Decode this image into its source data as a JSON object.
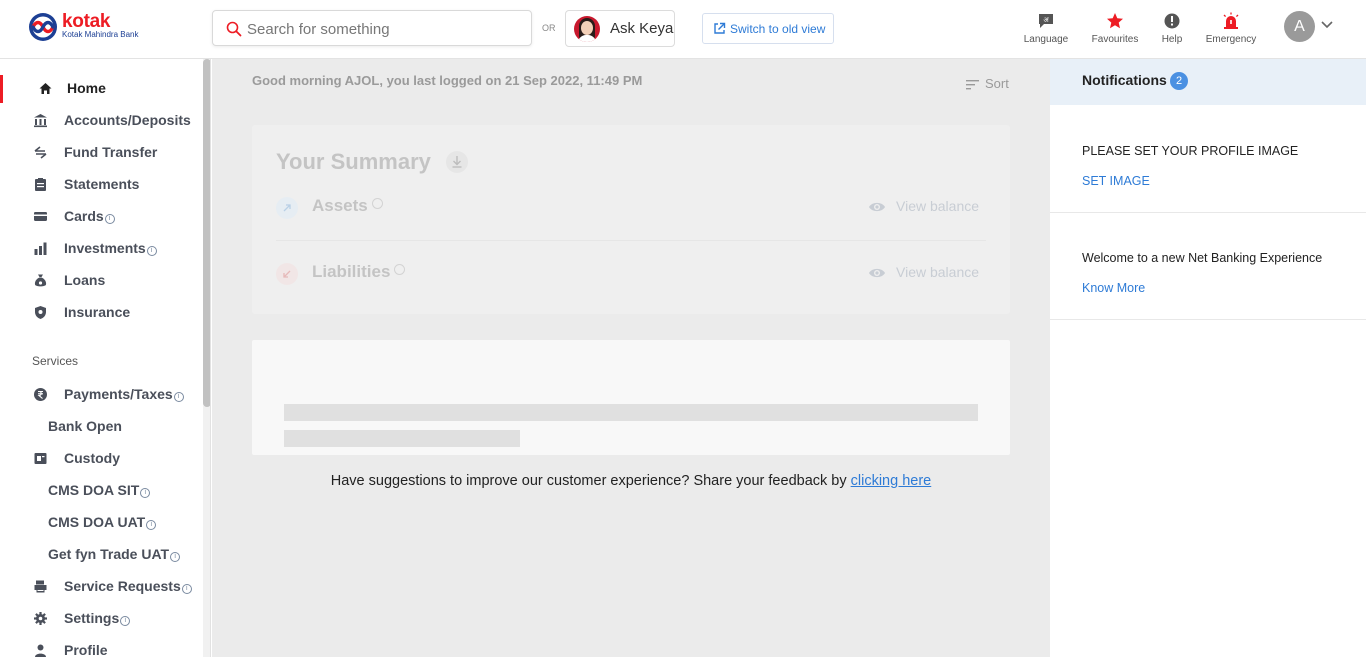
{
  "brand": {
    "name": "kotak",
    "subtitle": "Kotak Mahindra Bank",
    "primary_color": "#ed1c24",
    "secondary_color": "#1c3f94"
  },
  "header": {
    "search_placeholder": "Search for something",
    "or_label": "OR",
    "ask_keya_label": "Ask Keya",
    "switch_view_label": "Switch to old view",
    "actions": [
      {
        "label": "Language",
        "icon": "language-icon"
      },
      {
        "label": "Favourites",
        "icon": "star-icon"
      },
      {
        "label": "Help",
        "icon": "help-icon"
      },
      {
        "label": "Emergency",
        "icon": "emergency-siren-icon"
      }
    ],
    "user_initial": "A"
  },
  "sidebar": {
    "items": [
      {
        "label": "Home",
        "icon": "home-icon",
        "active": true
      },
      {
        "label": "Accounts/Deposits",
        "icon": "bank-icon"
      },
      {
        "label": "Fund Transfer",
        "icon": "transfer-icon"
      },
      {
        "label": "Statements",
        "icon": "statement-icon"
      },
      {
        "label": "Cards",
        "icon": "card-icon",
        "info": "i"
      },
      {
        "label": "Investments",
        "icon": "chart-bars-icon",
        "info": "i"
      },
      {
        "label": "Loans",
        "icon": "money-bag-icon"
      },
      {
        "label": "Insurance",
        "icon": "shield-icon"
      }
    ],
    "section_label": "Services",
    "services": [
      {
        "label": "Payments/Taxes",
        "icon": "rupee-icon",
        "info": "i"
      },
      {
        "label": "Bank Open"
      },
      {
        "label": "Custody",
        "icon": "custody-icon"
      },
      {
        "label": "CMS DOA SIT",
        "info": "i"
      },
      {
        "label": "CMS DOA UAT",
        "info": "i"
      },
      {
        "label": "Get fyn Trade UAT",
        "info": "i"
      },
      {
        "label": "Service Requests",
        "icon": "printer-icon",
        "info": "i"
      },
      {
        "label": "Settings",
        "icon": "gear-icon",
        "info": "i"
      },
      {
        "label": "Profile",
        "icon": "person-icon"
      }
    ]
  },
  "main": {
    "greeting": "Good morning AJOL, you last logged on 21 Sep 2022, 11:49 PM",
    "sort_label": "Sort",
    "summary": {
      "title": "Your Summary",
      "rows": [
        {
          "label": "Assets",
          "action": "View balance"
        },
        {
          "label": "Liabilities",
          "action": "View balance"
        }
      ]
    },
    "feedback_text": "Have suggestions to improve our customer experience? Share your feedback by ",
    "feedback_link": "clicking here"
  },
  "notifications": {
    "title": "Notifications",
    "count": "2",
    "items": [
      {
        "text": "PLEASE SET YOUR PROFILE IMAGE",
        "link": "SET IMAGE"
      },
      {
        "text": "Welcome to a new Net Banking Experience",
        "link": "Know More"
      }
    ]
  }
}
